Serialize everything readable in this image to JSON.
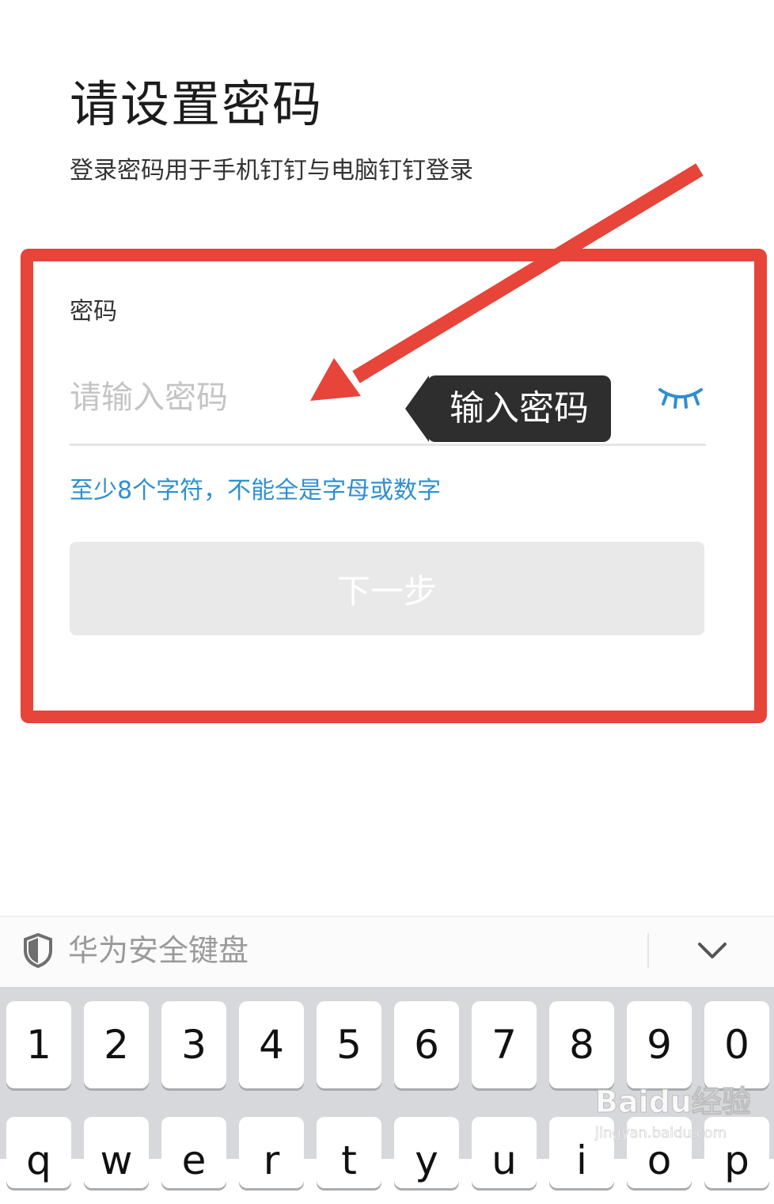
{
  "page": {
    "title": "请设置密码",
    "subtitle": "登录密码用于手机钉钉与电脑钉钉登录"
  },
  "password": {
    "label": "密码",
    "placeholder": "请输入密码",
    "hint": "至少8个字符，不能全是字母或数字",
    "eye_icon": "eye-closed-icon"
  },
  "next_button": {
    "label": "下一步"
  },
  "annotation": {
    "tooltip": "输入密码",
    "highlight_color": "#e7443a",
    "arrow_color": "#e7443a"
  },
  "keyboard": {
    "title": "华为安全键盘",
    "row1": [
      "1",
      "2",
      "3",
      "4",
      "5",
      "6",
      "7",
      "8",
      "9",
      "0"
    ],
    "row2": [
      "q",
      "w",
      "e",
      "r",
      "t",
      "y",
      "u",
      "i",
      "o",
      "p"
    ]
  },
  "colors": {
    "hint_blue": "#2f8fd0",
    "button_disabled": "#e9e9e9"
  },
  "watermark": {
    "brand": "Baidu经验",
    "url": "jingyan.baidu.com"
  }
}
